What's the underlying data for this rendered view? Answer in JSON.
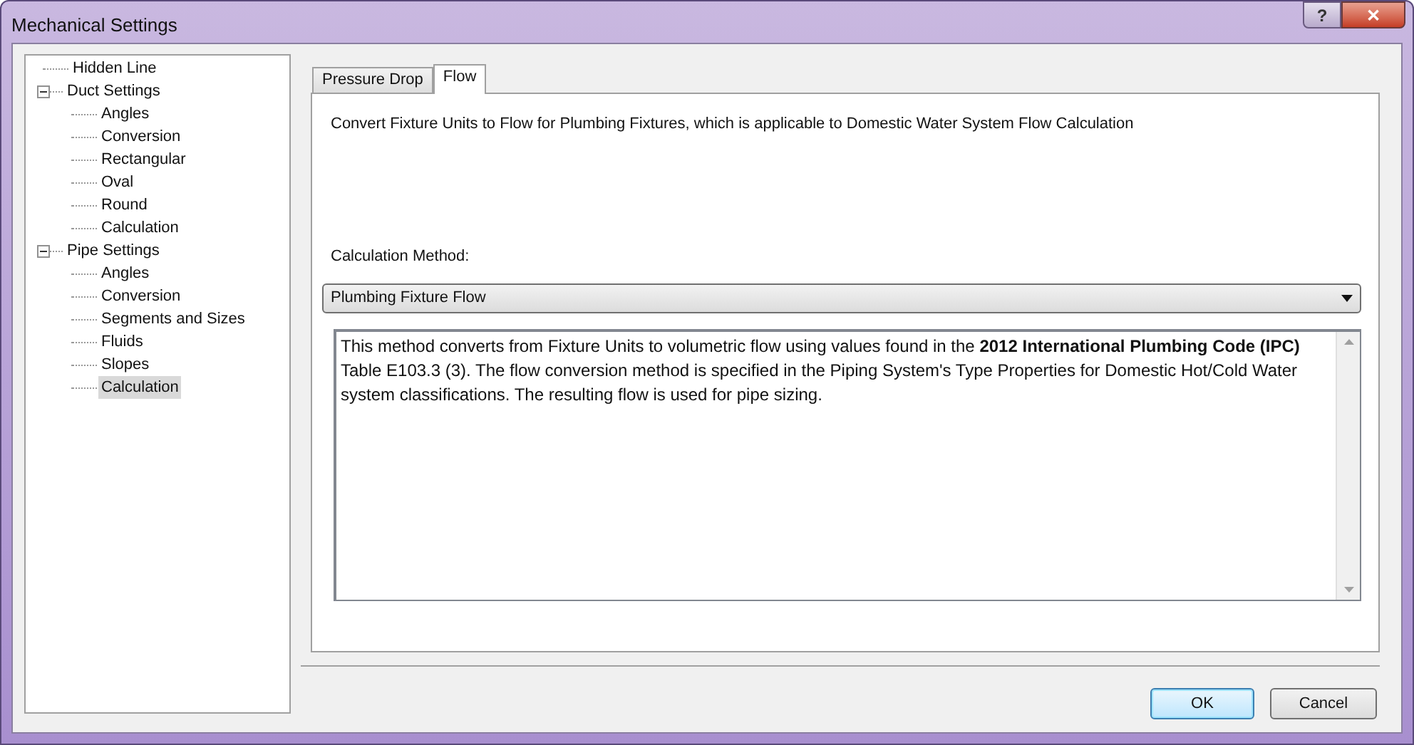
{
  "window": {
    "title": "Mechanical Settings",
    "buttons": [
      "?",
      "✕"
    ]
  },
  "tree": [
    {
      "label": "Hidden Line",
      "selected": false
    },
    {
      "label": "Duct Settings",
      "selected": false,
      "expanded": true,
      "children": [
        {
          "label": "Angles",
          "selected": false
        },
        {
          "label": "Conversion",
          "selected": false
        },
        {
          "label": "Rectangular",
          "selected": false
        },
        {
          "label": "Oval",
          "selected": false
        },
        {
          "label": "Round",
          "selected": false
        },
        {
          "label": "Calculation",
          "selected": false
        }
      ]
    },
    {
      "label": "Pipe Settings",
      "selected": false,
      "expanded": true,
      "children": [
        {
          "label": "Angles",
          "selected": false
        },
        {
          "label": "Conversion",
          "selected": false
        },
        {
          "label": "Segments and Sizes",
          "selected": false
        },
        {
          "label": "Fluids",
          "selected": false
        },
        {
          "label": "Slopes",
          "selected": false
        },
        {
          "label": "Calculation",
          "selected": true
        }
      ]
    }
  ],
  "tabs": [
    {
      "label": "Pressure Drop",
      "selected": false
    },
    {
      "label": "Flow",
      "selected": true
    }
  ],
  "description": "Convert Fixture Units to Flow for Plumbing Fixtures, which is applicable to Domestic Water System Flow Calculation",
  "calculation_method": {
    "label": "Calculation Method:",
    "value": "Plumbing Fixture Flow"
  },
  "method_text": "This method converts from Fixture Units to volumetric flow using values found in the **2012 International Plumbing Code (IPC)** Table E103.3 (3). The flow conversion method is specified in the Piping System's Type Properties for Domestic Hot/Cold Water system classifications. The resulting flow is used for pipe sizing.",
  "footer_buttons": [
    {
      "label": "OK",
      "kind": "default"
    },
    {
      "label": "Cancel",
      "kind": "normal"
    }
  ]
}
